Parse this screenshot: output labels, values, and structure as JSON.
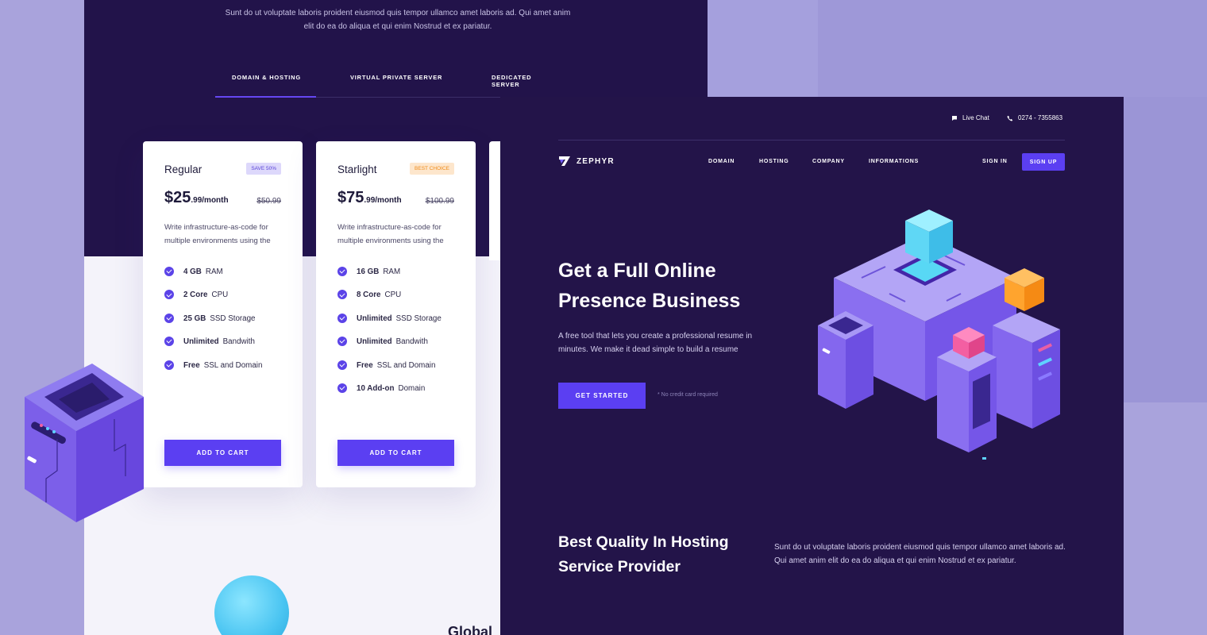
{
  "pricing_page": {
    "intro": "Sunt do ut voluptate laboris proident eiusmod quis tempor ullamco amet laboris ad. Qui amet anim elit do ea do aliqua et qui enim Nostrud et ex pariatur.",
    "tabs": [
      {
        "label": "DOMAIN & HOSTING",
        "active": true
      },
      {
        "label": "VIRTUAL PRIVATE SERVER",
        "active": false
      },
      {
        "label": "DEDICATED SERVER",
        "active": false
      }
    ],
    "plans": [
      {
        "name": "Regular",
        "badge": "SAVE 50%",
        "price_main": "$25",
        "price_suffix": ".99/month",
        "old_price": "$50.99",
        "description": "Write infrastructure-as-code for multiple environments using the",
        "features": [
          {
            "bold": "4 GB",
            "text": "RAM"
          },
          {
            "bold": "2 Core",
            "text": "CPU"
          },
          {
            "bold": "25 GB",
            "text": "SSD Storage"
          },
          {
            "bold": "Unlimited",
            "text": "Bandwith"
          },
          {
            "bold": "Free",
            "text": "SSL and Domain"
          }
        ],
        "button": "ADD TO CART"
      },
      {
        "name": "Starlight",
        "badge": "BEST CHOICE",
        "price_main": "$75",
        "price_suffix": ".99/month",
        "old_price": "$100.99",
        "description": "Write infrastructure-as-code for multiple environments using the",
        "features": [
          {
            "bold": "16 GB",
            "text": "RAM"
          },
          {
            "bold": "8 Core",
            "text": "CPU"
          },
          {
            "bold": "Unlimited",
            "text": "SSD Storage"
          },
          {
            "bold": "Unlimited",
            "text": "Bandwith"
          },
          {
            "bold": "Free",
            "text": "SSL and Domain"
          },
          {
            "bold": "10 Add-on",
            "text": "Domain"
          }
        ],
        "button": "ADD TO CART"
      }
    ],
    "bottom_text": "Global"
  },
  "hero_page": {
    "topbar": {
      "live_chat": "Live Chat",
      "phone": "0274 - 7355863"
    },
    "logo": "ZEPHYR",
    "nav": [
      "DOMAIN",
      "HOSTING",
      "COMPANY",
      "INFORMATIONS"
    ],
    "sign_in": "SIGN IN",
    "sign_up": "SIGN UP",
    "hero_title": "Get a Full Online Presence Business",
    "hero_desc": "A free tool that lets you create a professional resume in minutes. We make it dead simple to build a resume",
    "cta": "GET STARTED",
    "cta_note": "* No credit card required",
    "section_title": "Best Quality In Hosting Service Provider",
    "section_desc": "Sunt do ut voluptate laboris proident eiusmod quis tempor ullamco amet laboris ad. Qui amet anim elit do ea do aliqua et qui enim Nostrud et ex pariatur."
  },
  "colors": {
    "dark_bg": "#22134a",
    "accent": "#5b3ff2",
    "page_bg": "#a9a3dc",
    "badge_best": "#ef8a17"
  },
  "icons": [
    "check-icon",
    "chat-icon",
    "phone-icon",
    "zephyr-logo-icon"
  ]
}
